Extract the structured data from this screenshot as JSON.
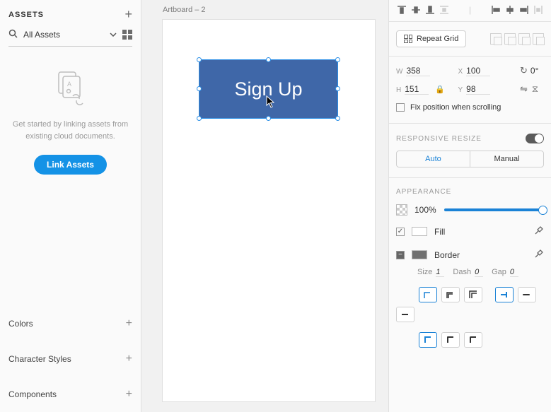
{
  "assets": {
    "title": "ASSETS",
    "search_label": "All Assets",
    "empty_text_1": "Get started by linking assets from",
    "empty_text_2": "existing cloud documents.",
    "link_btn": "Link Assets",
    "sections": {
      "colors": "Colors",
      "char_styles": "Character Styles",
      "components": "Components"
    }
  },
  "canvas": {
    "artboard_name": "Artboard – 2",
    "shape_text": "Sign Up"
  },
  "inspector": {
    "repeat_grid": "Repeat Grid",
    "transform": {
      "w": "358",
      "h": "151",
      "x": "100",
      "y": "98",
      "rotation": "0°"
    },
    "fix_position": "Fix position when scrolling",
    "responsive_title": "RESPONSIVE RESIZE",
    "resize_auto": "Auto",
    "resize_manual": "Manual",
    "appearance_title": "APPEARANCE",
    "opacity": "100%",
    "fill_label": "Fill",
    "border_label": "Border",
    "border": {
      "size_label": "Size",
      "size_val": "1",
      "dash_label": "Dash",
      "dash_val": "0",
      "gap_label": "Gap",
      "gap_val": "0"
    }
  }
}
